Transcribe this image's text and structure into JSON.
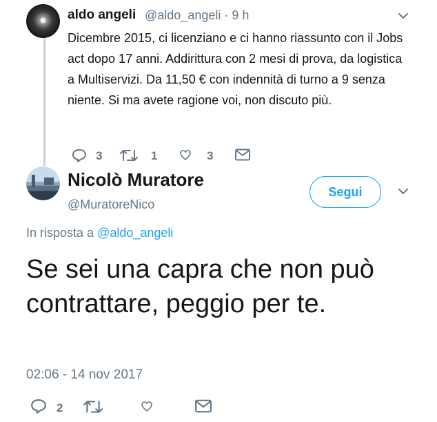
{
  "tweet_parent": {
    "author_name": "aldo angeli",
    "author_handle": "@aldo_angeli",
    "time": "9 h",
    "text": "Dicembre 2015, ci licenziano e ci hanno riassunto con il Jobs act dopo 17 anni. Addirittura con 2 mesi di prova, da logistica a Multiservizi. Da 11,50 € con indennità di turno a 9 senza niente. Si ma avete ragione voi, non discuto più.",
    "reply_count": "3",
    "retweet_count": "1",
    "like_count": "3"
  },
  "tweet_main": {
    "author_name": "Nicolò Muratore",
    "author_handle": "@MuratoreNico",
    "follow_label": "Segui",
    "reply_prefix": "In risposta a",
    "reply_to": "@aldo_angeli",
    "text": "Se sei una capra che non può contrattare, peggio per te.",
    "timestamp": "02:06 - 14 nov 2017",
    "reply_count": "2"
  },
  "colors": {
    "accent": "#1da1f2",
    "secondary_text": "#657786",
    "thread_line": "#c4cfd6"
  },
  "icons": [
    "chevron-down-icon",
    "reply-icon",
    "retweet-icon",
    "like-icon",
    "message-icon"
  ]
}
